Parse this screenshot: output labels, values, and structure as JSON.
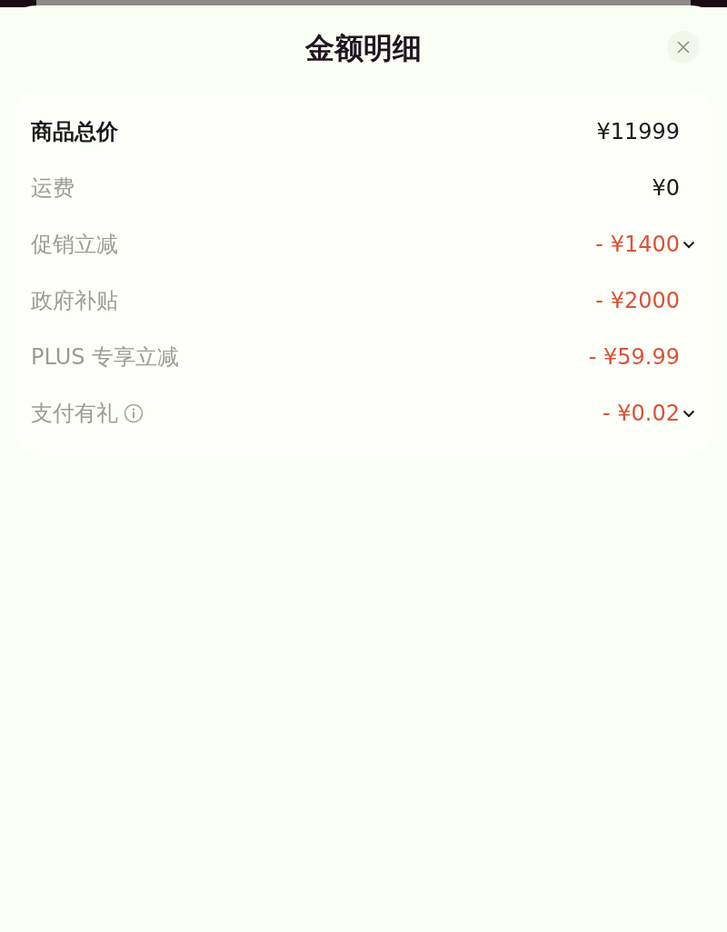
{
  "title": "金额明细",
  "rows": [
    {
      "label": "商品总价",
      "kind": "total",
      "amount": "¥11999",
      "info": false,
      "expandable": false
    },
    {
      "label": "运费",
      "kind": "plain",
      "amount": "¥0",
      "info": false,
      "expandable": false
    },
    {
      "label": "促销立减",
      "kind": "discount",
      "amount": "- ¥1400",
      "info": false,
      "expandable": true
    },
    {
      "label": "政府补贴",
      "kind": "discount",
      "amount": "- ¥2000",
      "info": false,
      "expandable": false
    },
    {
      "label": "PLUS 专享立减",
      "kind": "discount",
      "amount": "- ¥59.99",
      "info": false,
      "expandable": false
    },
    {
      "label": "支付有礼",
      "kind": "discount",
      "amount": "- ¥0.02",
      "info": true,
      "expandable": true
    }
  ]
}
